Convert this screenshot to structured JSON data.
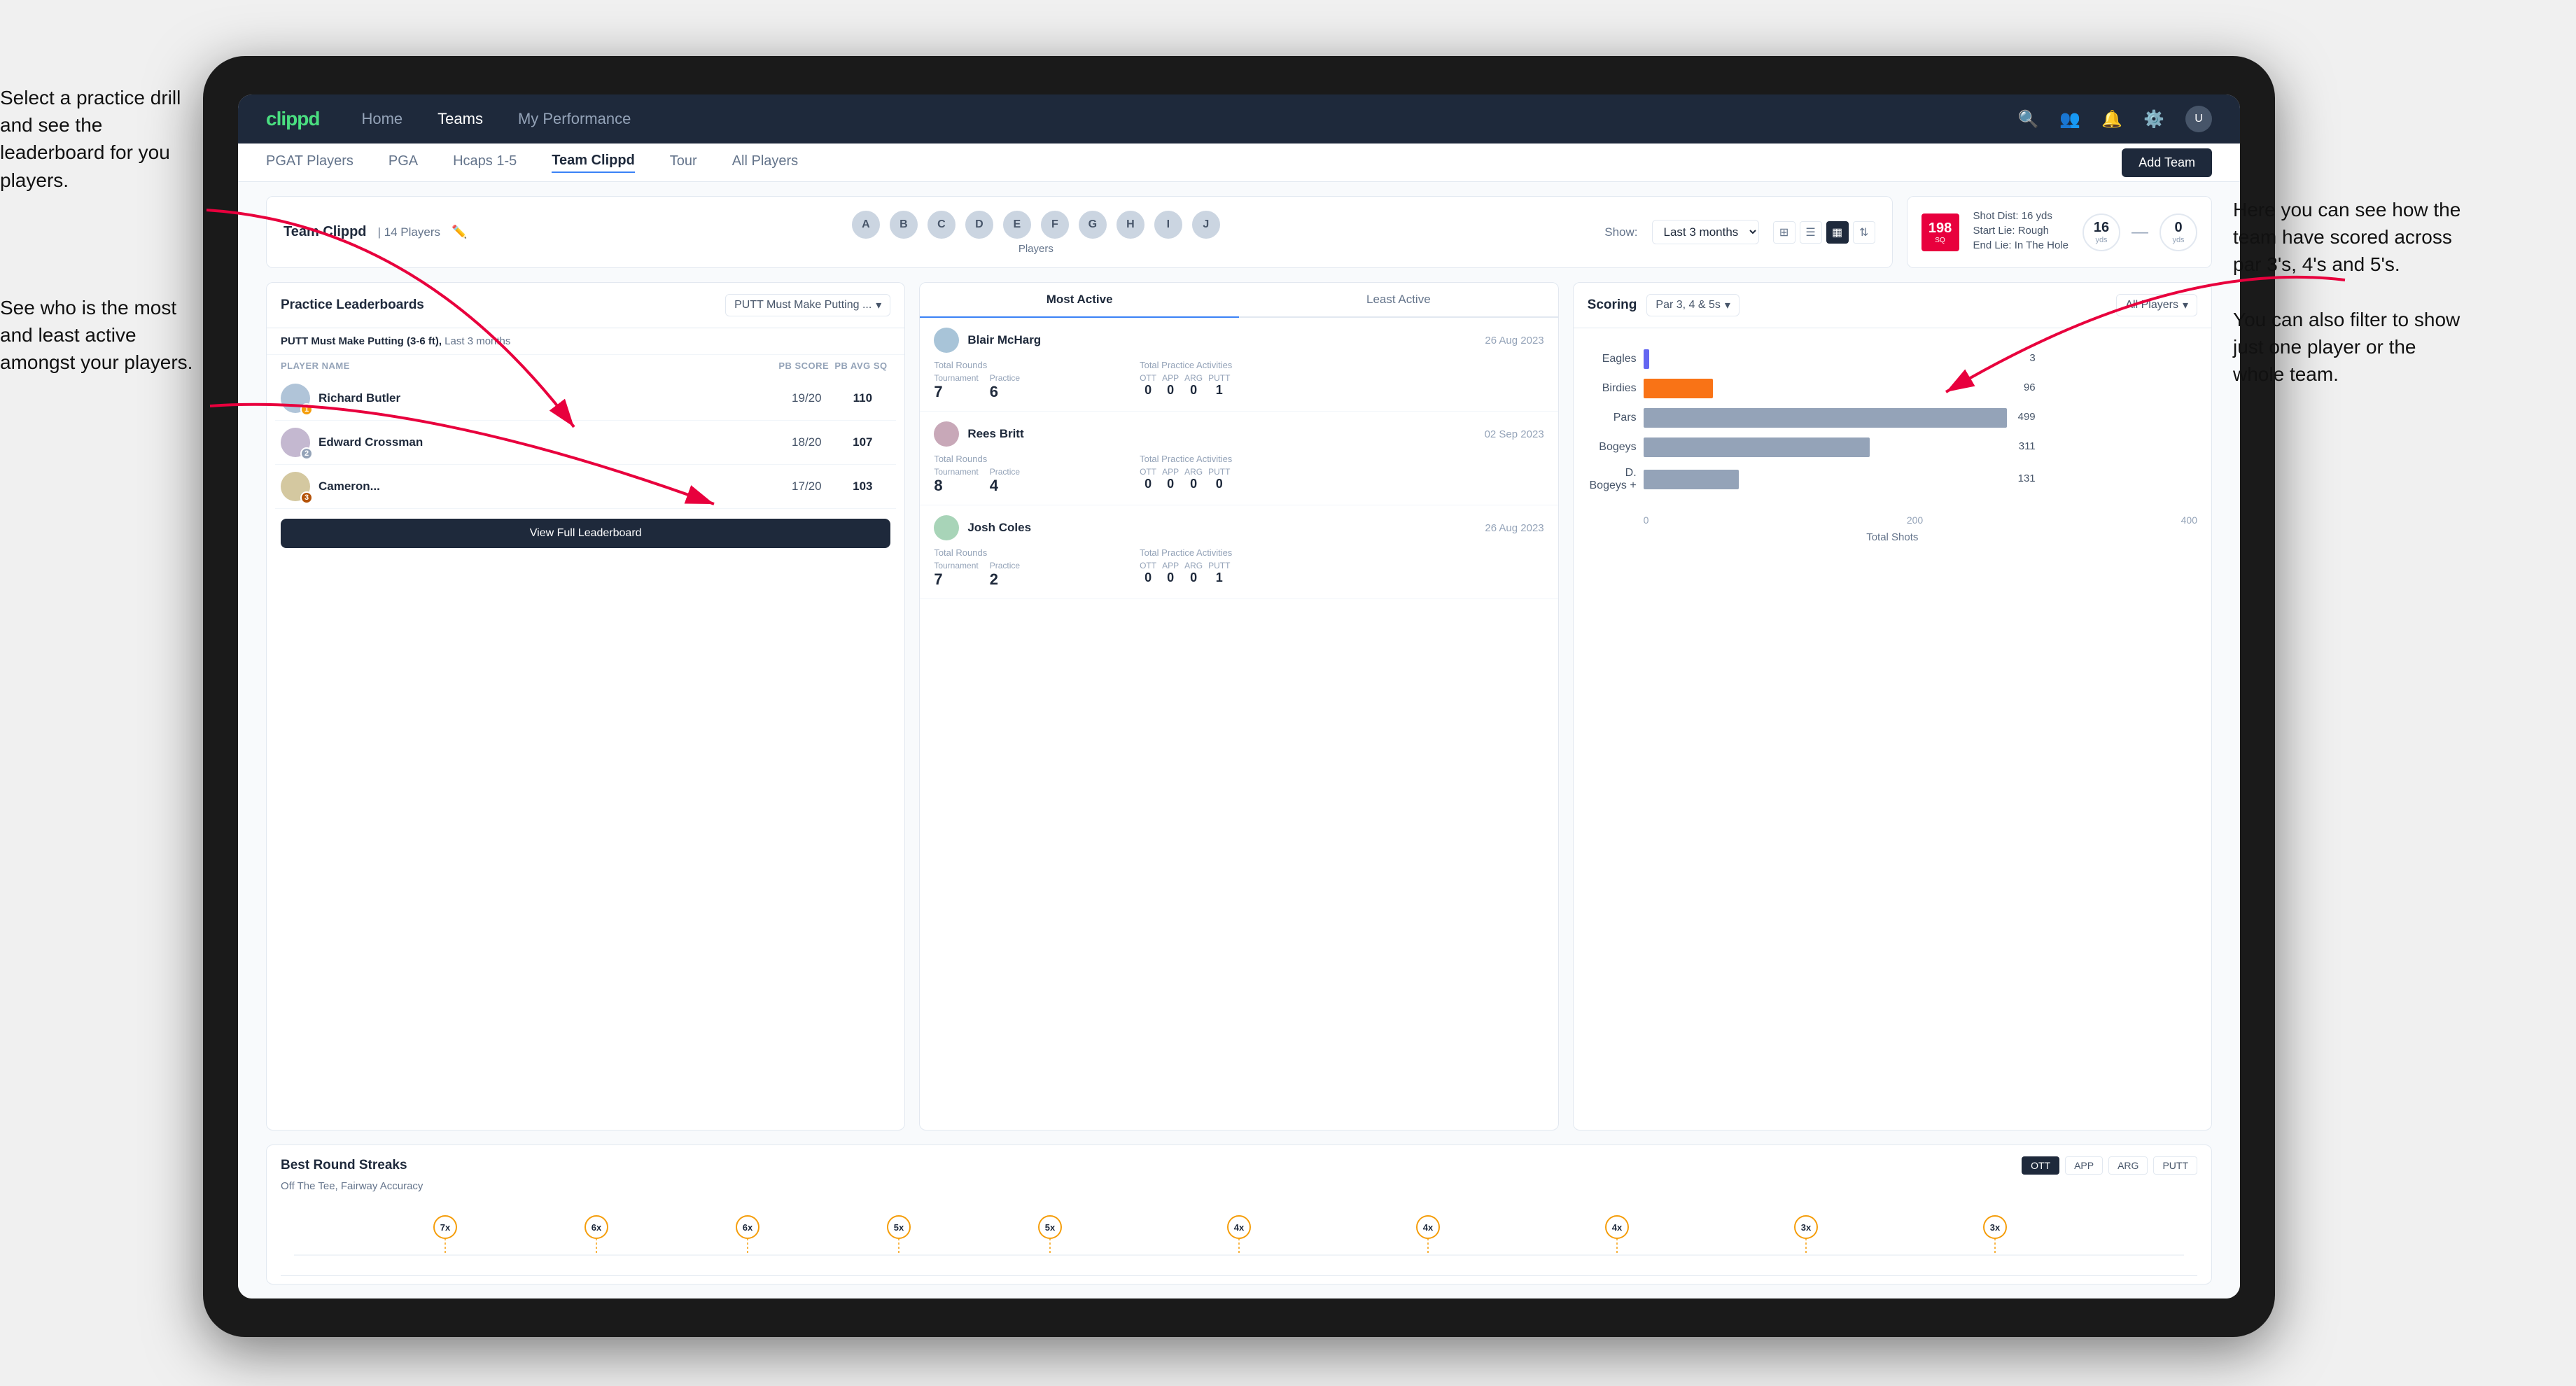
{
  "annotations": {
    "left1": "Select a practice drill and see the leaderboard for you players.",
    "left2": "See who is the most and least active amongst your players.",
    "right": "Here you can see how the team have scored across par 3's, 4's and 5's.\n\nYou can also filter to show just one player or the whole team."
  },
  "navbar": {
    "brand": "clippd",
    "items": [
      "Home",
      "Teams",
      "My Performance"
    ],
    "active": "Teams"
  },
  "subnav": {
    "items": [
      "PGAT Players",
      "PGA",
      "Hcaps 1-5",
      "Team Clippd",
      "Tour",
      "All Players"
    ],
    "active": "Team Clippd",
    "add_team_label": "Add Team"
  },
  "team": {
    "title": "Team Clippd",
    "count": "14 Players",
    "show_label": "Show:",
    "show_period": "Last 3 months",
    "players_label": "Players"
  },
  "shot_card": {
    "number": "198",
    "unit": "SQ",
    "shot_dist_label": "Shot Dist: 16 yds",
    "start_lie_label": "Start Lie: Rough",
    "end_lie_label": "End Lie: In The Hole",
    "yardage1": "16",
    "yardage1_label": "yds",
    "yardage2": "0",
    "yardage2_label": "yds"
  },
  "practice_leaderboard": {
    "title": "Practice Leaderboards",
    "dropdown": "PUTT Must Make Putting ...",
    "subtitle_drill": "PUTT Must Make Putting (3-6 ft),",
    "subtitle_period": "Last 3 months",
    "cols": [
      "PLAYER NAME",
      "PB SCORE",
      "PB AVG SQ"
    ],
    "players": [
      {
        "name": "Richard Butler",
        "score": "19/20",
        "avg": "110",
        "badge": "1",
        "badge_type": "gold"
      },
      {
        "name": "Edward Crossman",
        "score": "18/20",
        "avg": "107",
        "badge": "2",
        "badge_type": "silver"
      },
      {
        "name": "Cameron...",
        "score": "17/20",
        "avg": "103",
        "badge": "3",
        "badge_type": "bronze"
      }
    ],
    "view_full_label": "View Full Leaderboard"
  },
  "activity": {
    "tabs": [
      "Most Active",
      "Least Active"
    ],
    "active_tab": "Most Active",
    "players": [
      {
        "name": "Blair McHarg",
        "date": "26 Aug 2023",
        "total_rounds_label": "Total Rounds",
        "tournament_label": "Tournament",
        "practice_label": "Practice",
        "tournament_val": "7",
        "practice_val": "6",
        "total_practice_label": "Total Practice Activities",
        "ott_label": "OTT",
        "app_label": "APP",
        "arg_label": "ARG",
        "putt_label": "PUTT",
        "ott_val": "0",
        "app_val": "0",
        "arg_val": "0",
        "putt_val": "1"
      },
      {
        "name": "Rees Britt",
        "date": "02 Sep 2023",
        "total_rounds_label": "Total Rounds",
        "tournament_label": "Tournament",
        "practice_label": "Practice",
        "tournament_val": "8",
        "practice_val": "4",
        "total_practice_label": "Total Practice Activities",
        "ott_label": "OTT",
        "app_label": "APP",
        "arg_label": "ARG",
        "putt_label": "PUTT",
        "ott_val": "0",
        "app_val": "0",
        "arg_val": "0",
        "putt_val": "0"
      },
      {
        "name": "Josh Coles",
        "date": "26 Aug 2023",
        "total_rounds_label": "Total Rounds",
        "tournament_label": "Tournament",
        "practice_label": "Practice",
        "tournament_val": "7",
        "practice_val": "2",
        "total_practice_label": "Total Practice Activities",
        "ott_label": "OTT",
        "app_label": "APP",
        "arg_label": "ARG",
        "putt_label": "PUTT",
        "ott_val": "0",
        "app_val": "0",
        "arg_val": "0",
        "putt_val": "1"
      }
    ]
  },
  "scoring": {
    "title": "Scoring",
    "filter": "Par 3, 4 & 5s",
    "players_filter": "All Players",
    "bars": [
      {
        "label": "Eagles",
        "value": 3,
        "max": 500,
        "color": "#6366f1"
      },
      {
        "label": "Birdies",
        "value": 96,
        "max": 500,
        "color": "#f97316"
      },
      {
        "label": "Pars",
        "value": 499,
        "max": 500,
        "color": "#94a3b8"
      },
      {
        "label": "Bogeys",
        "value": 311,
        "max": 500,
        "color": "#94a3b8"
      },
      {
        "label": "D. Bogeys +",
        "value": 131,
        "max": 500,
        "color": "#94a3b8"
      }
    ],
    "x_axis": [
      "0",
      "200",
      "400"
    ],
    "x_title": "Total Shots"
  },
  "streaks": {
    "title": "Best Round Streaks",
    "subtitle": "Off The Tee, Fairway Accuracy",
    "filters": [
      "OTT",
      "APP",
      "ARG",
      "PUTT"
    ],
    "active_filter": "OTT",
    "data_points": [
      {
        "x": 8,
        "label": "7x"
      },
      {
        "x": 16,
        "label": "6x"
      },
      {
        "x": 24,
        "label": "6x"
      },
      {
        "x": 32,
        "label": "5x"
      },
      {
        "x": 40,
        "label": "5x"
      },
      {
        "x": 50,
        "label": "4x"
      },
      {
        "x": 60,
        "label": "4x"
      },
      {
        "x": 70,
        "label": "4x"
      },
      {
        "x": 80,
        "label": "3x"
      },
      {
        "x": 90,
        "label": "3x"
      }
    ]
  }
}
